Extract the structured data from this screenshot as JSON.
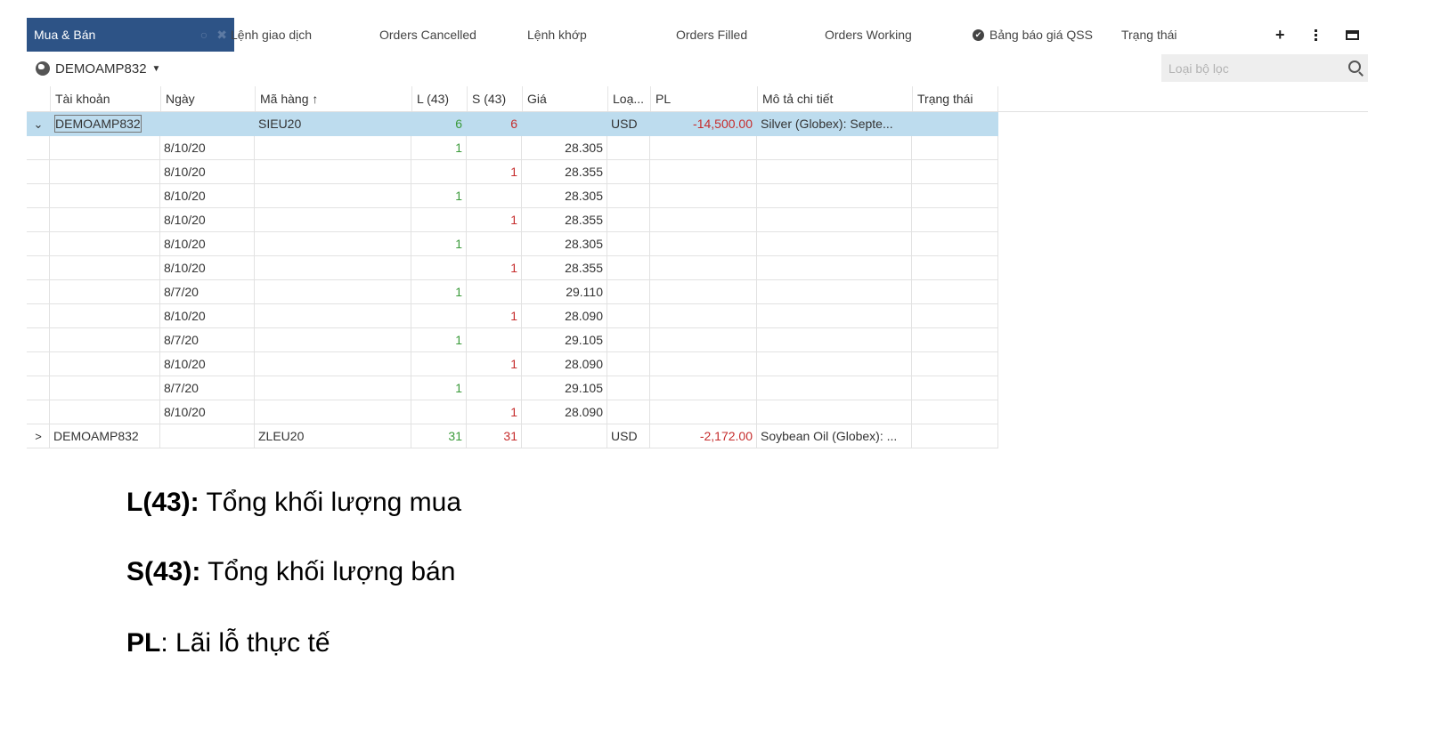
{
  "tabs": {
    "active": "Mua & Bán",
    "items": [
      "Lệnh giao dịch",
      "Orders Cancelled",
      "Lệnh khớp",
      "Orders Filled",
      "Orders Working",
      "Bảng báo giá QSS",
      "Trạng thái"
    ]
  },
  "account_selector": {
    "label": "DEMOAMP832"
  },
  "filter": {
    "placeholder": "Loại bộ lọc"
  },
  "columns": [
    "Tài khoản",
    "Ngày",
    "Mã hàng",
    "L (43)",
    "S (43)",
    "Giá",
    "Loạ...",
    "PL",
    "Mô tả chi tiết",
    "Trạng thái"
  ],
  "sort_indicator": "↑",
  "groups": [
    {
      "account": "DEMOAMP832",
      "symbol": "SIEU20",
      "long": "6",
      "short": "6",
      "currency": "USD",
      "pl": "-14,500.00",
      "description": "Silver (Globex): Septe...",
      "expanded": true,
      "fills": [
        {
          "date": "8/10/20",
          "long": "1",
          "short": "",
          "price": "28.305"
        },
        {
          "date": "8/10/20",
          "long": "",
          "short": "1",
          "price": "28.355"
        },
        {
          "date": "8/10/20",
          "long": "1",
          "short": "",
          "price": "28.305"
        },
        {
          "date": "8/10/20",
          "long": "",
          "short": "1",
          "price": "28.355"
        },
        {
          "date": "8/10/20",
          "long": "1",
          "short": "",
          "price": "28.305"
        },
        {
          "date": "8/10/20",
          "long": "",
          "short": "1",
          "price": "28.355"
        },
        {
          "date": "8/7/20",
          "long": "1",
          "short": "",
          "price": "29.110"
        },
        {
          "date": "8/10/20",
          "long": "",
          "short": "1",
          "price": "28.090"
        },
        {
          "date": "8/7/20",
          "long": "1",
          "short": "",
          "price": "29.105"
        },
        {
          "date": "8/10/20",
          "long": "",
          "short": "1",
          "price": "28.090"
        },
        {
          "date": "8/7/20",
          "long": "1",
          "short": "",
          "price": "29.105"
        },
        {
          "date": "8/10/20",
          "long": "",
          "short": "1",
          "price": "28.090"
        }
      ]
    },
    {
      "account": "DEMOAMP832",
      "symbol": "ZLEU20",
      "long": "31",
      "short": "31",
      "currency": "USD",
      "pl": "-2,172.00",
      "description": "Soybean Oil (Globex): ...",
      "expanded": false
    }
  ],
  "notes": [
    {
      "term": "L(43):",
      "text": " Tổng khối lượng mua"
    },
    {
      "term": "S(43):",
      "text": " Tổng khối lượng bán"
    },
    {
      "term": "PL",
      "text": ": Lãi lỗ thực tế"
    }
  ],
  "colors": {
    "tab_active_bg": "#2d5386",
    "group_row_bg": "#bddcee",
    "long": "#3a9a3a",
    "short": "#c62d2d"
  }
}
